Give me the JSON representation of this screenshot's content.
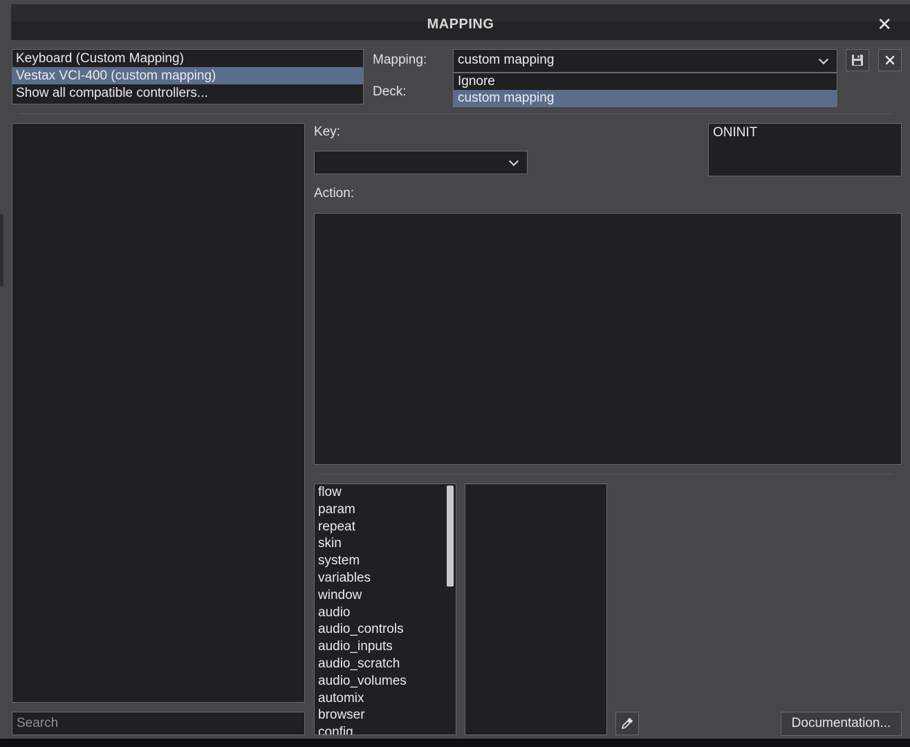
{
  "window": {
    "title": "MAPPING"
  },
  "devices": [
    {
      "label": "Keyboard (Custom Mapping)",
      "selected": false
    },
    {
      "label": "Vestax VCI-400 (custom mapping)",
      "selected": true
    },
    {
      "label": "Show all compatible controllers...",
      "selected": false
    }
  ],
  "mapping": {
    "label": "Mapping:",
    "value": "custom mapping",
    "options": [
      {
        "label": "Ignore",
        "selected": false
      },
      {
        "label": "custom mapping",
        "selected": true
      }
    ]
  },
  "deck": {
    "label": "Deck:"
  },
  "key": {
    "label": "Key:",
    "value": ""
  },
  "event": {
    "value": "ONINIT"
  },
  "action": {
    "label": "Action:",
    "value": ""
  },
  "categories": [
    "flow",
    "param",
    "repeat",
    "skin",
    "system",
    "variables",
    "window",
    "audio",
    "audio_controls",
    "audio_inputs",
    "audio_scratch",
    "audio_volumes",
    "automix",
    "browser",
    "config"
  ],
  "search": {
    "placeholder": "Search",
    "value": ""
  },
  "buttons": {
    "documentation": "Documentation..."
  },
  "icons": {
    "save": "floppy-disk-icon",
    "delete": "close-icon",
    "picker": "eyedropper-icon",
    "close": "close-icon"
  }
}
